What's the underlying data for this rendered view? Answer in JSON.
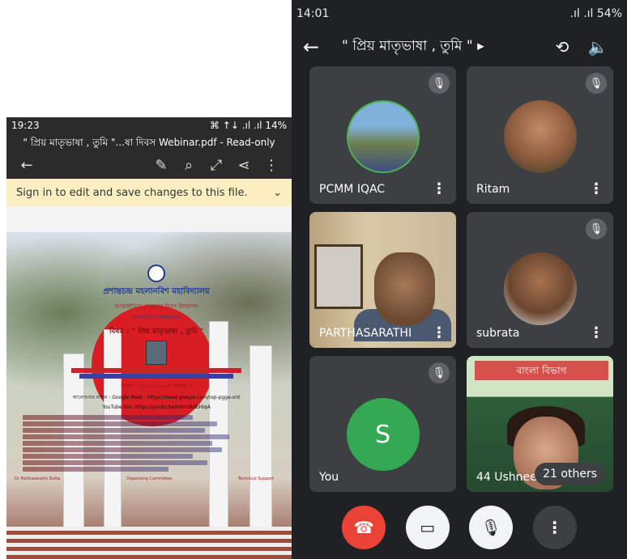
{
  "left_phone": {
    "status": {
      "time": "19:23",
      "icons": "⌘ ↑↓ .ıl .ıl",
      "battery": "14%"
    },
    "title": "\" প্রিয় মাতৃভাষা , তুমি \"...ষা দিবস Webinar.pdf - Read-only",
    "toolbar_icons": [
      "back-arrow-icon",
      "edit-icon",
      "search-icon",
      "fullscreen-icon",
      "share-icon",
      "more-vert-icon"
    ],
    "banner_text": "Sign in to edit and save changes to this file.",
    "doc": {
      "college": "প্রশান্তচন্দ্র মহলানবিশ মহাবিদ্যালয়",
      "event": "আন্তর্জাতিক মাতৃভাষা দিবস উদযাপন",
      "line3": "বাংলা বিভাগ আয়োজিত",
      "topic": "বিষয় : \" প্রিয় মাতৃভাষা , তুমি \"",
      "date": "তারিখ : ২১/০২/২০২২ ( সোমবার )",
      "platform": "আলোচনার মাধ্যম : Google Meet : https://meet.google.com/nqi-pgge-xnt",
      "youtube": "YouTube link: https://youtu.be/kWnVkdbHiqA",
      "sig_left": "Dr Parthasarathi Dutta",
      "sig_mid": "Organizing Committee",
      "sig_right": "Technical Support"
    }
  },
  "right_phone": {
    "status": {
      "time": "14:01",
      "battery": "54%"
    },
    "header": {
      "title": "\" প্রিয় মাতৃভাষা , তুমি \""
    },
    "tiles": [
      {
        "name": "PCMM IQAC",
        "muted": true
      },
      {
        "name": "Ritam",
        "muted": true
      },
      {
        "name": "PARTHASARATHI",
        "muted": false
      },
      {
        "name": "subrata",
        "muted": true
      },
      {
        "name": "You",
        "initial": "S",
        "muted": true
      },
      {
        "name": "44 Ushnees",
        "muted": false,
        "video_banner": "বাংলা বিভাগ"
      }
    ],
    "others_label": "21 others"
  }
}
